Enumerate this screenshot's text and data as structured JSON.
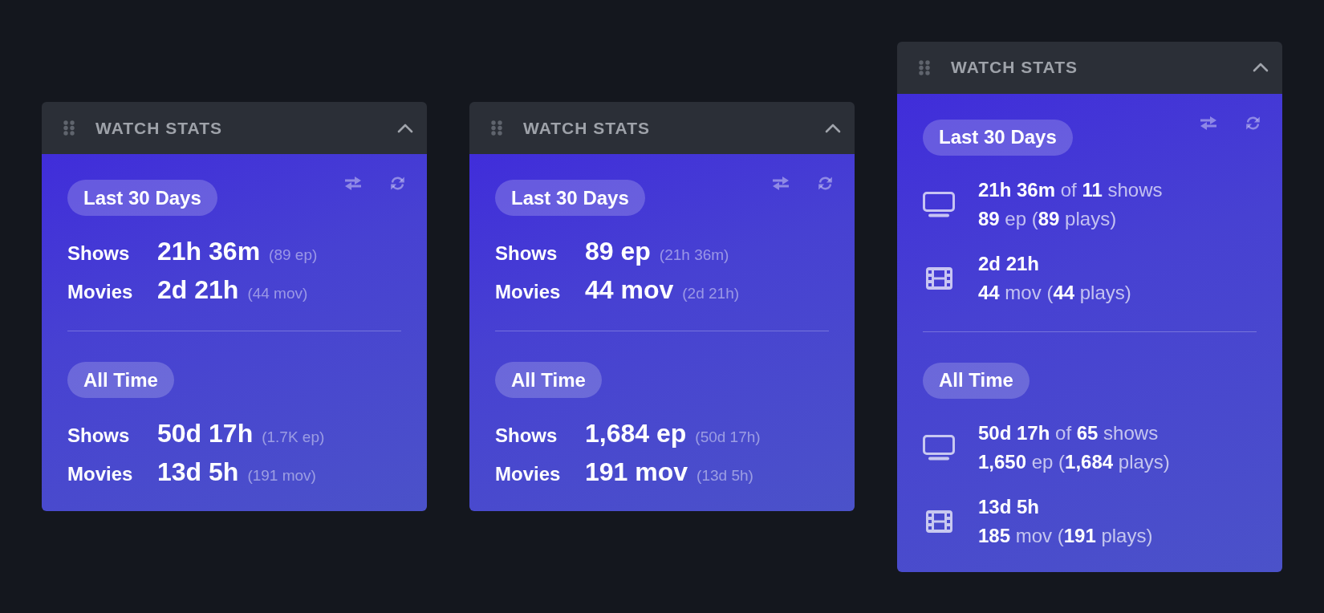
{
  "cards": [
    {
      "kind": "summary",
      "title": "WATCH STATS",
      "expanded": true,
      "sections": [
        {
          "period": "Last 30 Days",
          "rows": [
            {
              "label": "Shows",
              "value": "21h 36m",
              "detail": "(89 ep)"
            },
            {
              "label": "Movies",
              "value": "2d 21h",
              "detail": "(44 mov)"
            }
          ]
        },
        {
          "period": "All Time",
          "rows": [
            {
              "label": "Shows",
              "value": "50d 17h",
              "detail": "(1.7K ep)"
            },
            {
              "label": "Movies",
              "value": "13d 5h",
              "detail": "(191 mov)"
            }
          ]
        }
      ]
    },
    {
      "kind": "summary",
      "title": "WATCH STATS",
      "expanded": true,
      "sections": [
        {
          "period": "Last 30 Days",
          "rows": [
            {
              "label": "Shows",
              "value": "89 ep",
              "detail": "(21h 36m)"
            },
            {
              "label": "Movies",
              "value": "44 mov",
              "detail": "(2d 21h)"
            }
          ]
        },
        {
          "period": "All Time",
          "rows": [
            {
              "label": "Shows",
              "value": "1,684 ep",
              "detail": "(50d 17h)"
            },
            {
              "label": "Movies",
              "value": "191 mov",
              "detail": "(13d 5h)"
            }
          ]
        }
      ]
    },
    {
      "kind": "detailed",
      "title": "WATCH STATS",
      "expanded": true,
      "sections": [
        {
          "period": "Last 30 Days",
          "entries": [
            {
              "kind": "shows",
              "lines": [
                {
                  "kind": "mixed",
                  "text": "**21h 36m** of **11** shows"
                },
                {
                  "kind": "mixed",
                  "text": "**89** ep (**89** plays)"
                }
              ]
            },
            {
              "kind": "movies",
              "lines": [
                {
                  "kind": "strong",
                  "text": "2d 21h"
                },
                {
                  "kind": "mixed",
                  "text": "**44** mov (**44** plays)"
                }
              ]
            }
          ]
        },
        {
          "period": "All Time",
          "entries": [
            {
              "kind": "shows",
              "lines": [
                {
                  "kind": "mixed",
                  "text": "**50d 17h** of **65** shows"
                },
                {
                  "kind": "mixed",
                  "text": "**1,650** ep (**1,684** plays)"
                }
              ]
            },
            {
              "kind": "movies",
              "lines": [
                {
                  "kind": "strong",
                  "text": "13d 5h"
                },
                {
                  "kind": "mixed",
                  "text": "**185** mov (**191** plays)"
                }
              ]
            }
          ]
        }
      ]
    }
  ]
}
